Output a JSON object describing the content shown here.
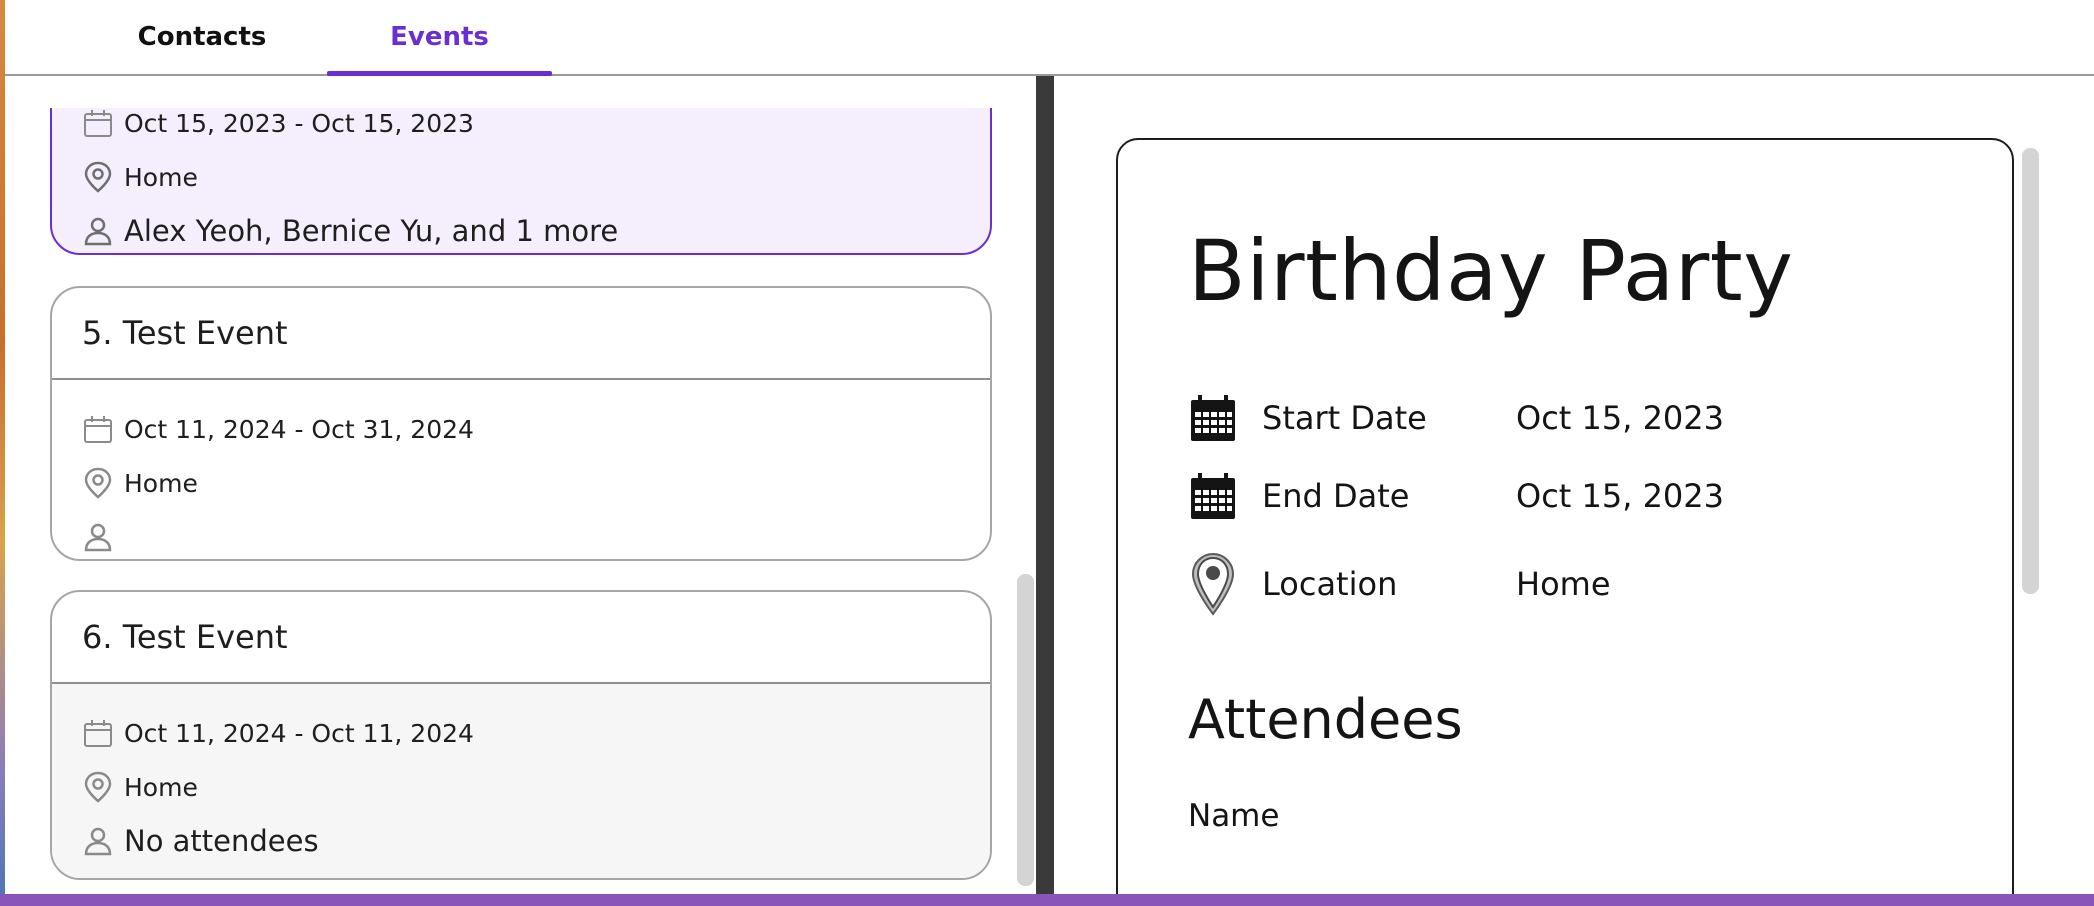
{
  "tabs": [
    {
      "label": "Contacts",
      "active": false
    },
    {
      "label": "Events",
      "active": true
    }
  ],
  "colors": {
    "accent": "#6a2fd1",
    "selected_card_bg": "#f5eefd",
    "bottom_bar": "#8a55b8"
  },
  "event_list": {
    "selected_card": {
      "dates": "Oct 15, 2023 - Oct 15, 2023",
      "location": "Home",
      "attendees": "Alex Yeoh, Bernice Yu, and 1 more"
    },
    "cards": [
      {
        "title": "5. Test Event",
        "dates": "Oct 11, 2024 - Oct 31, 2024",
        "location": "Home",
        "attendees": ""
      },
      {
        "title": "6. Test Event",
        "dates": "Oct 11, 2024 - Oct 11, 2024",
        "location": "Home",
        "attendees": "No attendees"
      }
    ]
  },
  "detail": {
    "title": "Birthday Party",
    "start_label": "Start Date",
    "start_value": "Oct 15, 2023",
    "end_label": "End Date",
    "end_value": "Oct 15, 2023",
    "location_label": "Location",
    "location_value": "Home",
    "attendees_heading": "Attendees",
    "name_column": "Name"
  },
  "icons": {
    "calendar": "calendar-icon",
    "location": "location-pin-icon",
    "person": "person-icon"
  }
}
